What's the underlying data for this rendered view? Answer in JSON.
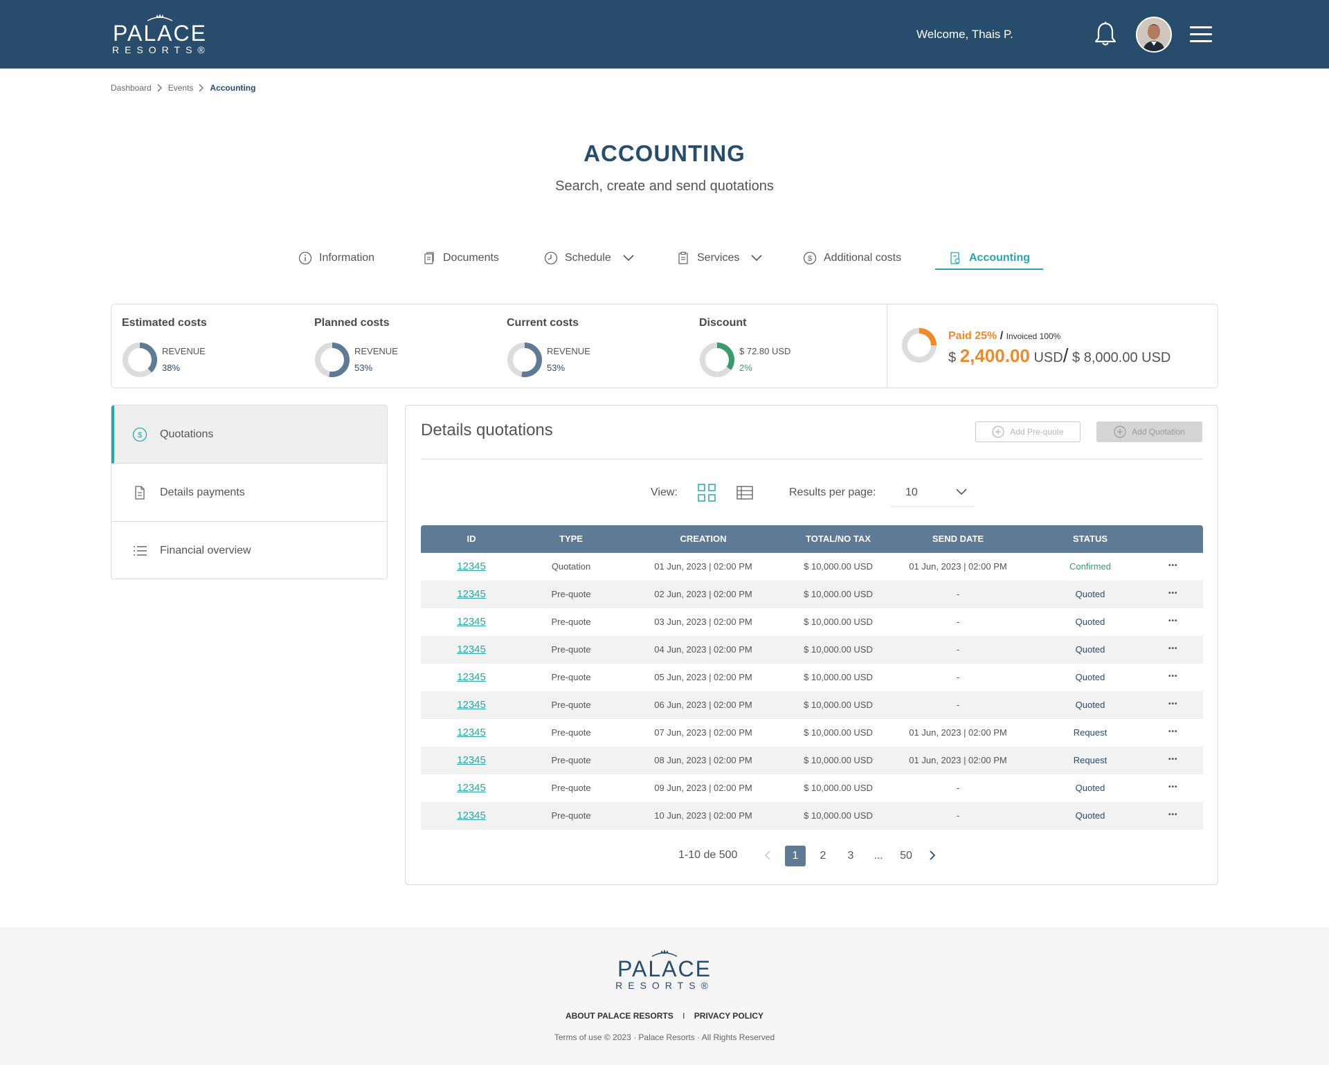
{
  "header": {
    "logo_main": "PALACE",
    "logo_sub": "RESORTS®",
    "welcome": "Welcome, Thais P."
  },
  "breadcrumb": [
    "Dashboard",
    "Events",
    "Accounting"
  ],
  "page": {
    "title": "ACCOUNTING",
    "subtitle": "Search, create and send quotations"
  },
  "tabs": [
    {
      "label": "Information",
      "icon": "info-icon"
    },
    {
      "label": "Documents",
      "icon": "documents-icon"
    },
    {
      "label": "Schedule",
      "icon": "clock-icon",
      "dropdown": true
    },
    {
      "label": "Services",
      "icon": "clipboard-icon",
      "dropdown": true
    },
    {
      "label": "Additional costs",
      "icon": "dollar-circle-icon"
    },
    {
      "label": "Accounting",
      "icon": "receipt-icon",
      "active": true
    }
  ],
  "summary": {
    "metrics": [
      {
        "title": "Estimated costs",
        "label": "REVENUE",
        "value": "38%",
        "percent": 38,
        "color": "#5e7a94"
      },
      {
        "title": "Planned costs",
        "label": "REVENUE",
        "value": "53%",
        "percent": 53,
        "color": "#5e7a94"
      },
      {
        "title": "Current costs",
        "label": "REVENUE",
        "value": "53%",
        "percent": 53,
        "color": "#5e7a94"
      },
      {
        "title": "Discount",
        "label": "$ 72.80 USD",
        "value": "2%",
        "percent": 35,
        "color": "#3c9a6a"
      }
    ],
    "paid": {
      "paid_label": "Paid 25%",
      "slash": "/",
      "invoiced_label": "Invoiced 100%",
      "currency": "$",
      "amount": "2,400.00",
      "amount_unit": "USD",
      "total": "$ 8,000.00 USD",
      "percent": 25,
      "color": "#ef8a2c"
    }
  },
  "sidebar": {
    "items": [
      {
        "label": "Quotations",
        "icon": "dollar-circle-icon",
        "active": true
      },
      {
        "label": "Details payments",
        "icon": "document-icon"
      },
      {
        "label": "Financial overview",
        "icon": "list-icon"
      }
    ]
  },
  "panel": {
    "title": "Details quotations",
    "add_prequote": "Add Pre-quote",
    "add_quotation": "Add Quotation",
    "view_label": "View:",
    "rpp_label": "Results per page:",
    "rpp_value": "10"
  },
  "table": {
    "columns": [
      "ID",
      "TYPE",
      "CREATION",
      "TOTAL/NO TAX",
      "SEND DATE",
      "STATUS"
    ],
    "rows": [
      {
        "id": "12345",
        "type": "Quotation",
        "creation": "01 Jun, 2023 | 02:00 PM",
        "total": "$ 10,000.00 USD",
        "send": "01 Jun, 2023 | 02:00 PM",
        "status": "Confirmed"
      },
      {
        "id": "12345",
        "type": "Pre-quote",
        "creation": "02 Jun, 2023 | 02:00 PM",
        "total": "$ 10,000.00 USD",
        "send": "-",
        "status": "Quoted"
      },
      {
        "id": "12345",
        "type": "Pre-quote",
        "creation": "03 Jun, 2023 | 02:00 PM",
        "total": "$ 10,000.00 USD",
        "send": "-",
        "status": "Quoted"
      },
      {
        "id": "12345",
        "type": "Pre-quote",
        "creation": "04 Jun, 2023 | 02:00 PM",
        "total": "$ 10,000.00 USD",
        "send": "-",
        "status": "Quoted"
      },
      {
        "id": "12345",
        "type": "Pre-quote",
        "creation": "05 Jun, 2023 | 02:00 PM",
        "total": "$ 10,000.00 USD",
        "send": "-",
        "status": "Quoted"
      },
      {
        "id": "12345",
        "type": "Pre-quote",
        "creation": "06 Jun, 2023 | 02:00 PM",
        "total": "$ 10,000.00 USD",
        "send": "-",
        "status": "Quoted"
      },
      {
        "id": "12345",
        "type": "Pre-quote",
        "creation": "07 Jun, 2023 | 02:00 PM",
        "total": "$ 10,000.00 USD",
        "send": "01 Jun, 2023 | 02:00 PM",
        "status": "Request"
      },
      {
        "id": "12345",
        "type": "Pre-quote",
        "creation": "08 Jun, 2023 | 02:00 PM",
        "total": "$ 10,000.00 USD",
        "send": "01 Jun, 2023 | 02:00 PM",
        "status": "Request"
      },
      {
        "id": "12345",
        "type": "Pre-quote",
        "creation": "09 Jun, 2023 | 02:00 PM",
        "total": "$ 10,000.00 USD",
        "send": "-",
        "status": "Quoted"
      },
      {
        "id": "12345",
        "type": "Pre-quote",
        "creation": "10 Jun, 2023 | 02:00 PM",
        "total": "$ 10,000.00 USD",
        "send": "-",
        "status": "Quoted"
      }
    ]
  },
  "pagination": {
    "range": "1-10 de 500",
    "pages": [
      "1",
      "2",
      "3",
      "...",
      "50"
    ],
    "current": "1"
  },
  "footer": {
    "logo_main": "PALACE",
    "logo_sub": "RESORTS®",
    "link_about": "ABOUT PALACE RESORTS",
    "link_sep": "I",
    "link_privacy": "PRIVACY POLICY",
    "copyright": "Terms of use © 2023 · Palace Resorts · All Rights Reserved"
  }
}
